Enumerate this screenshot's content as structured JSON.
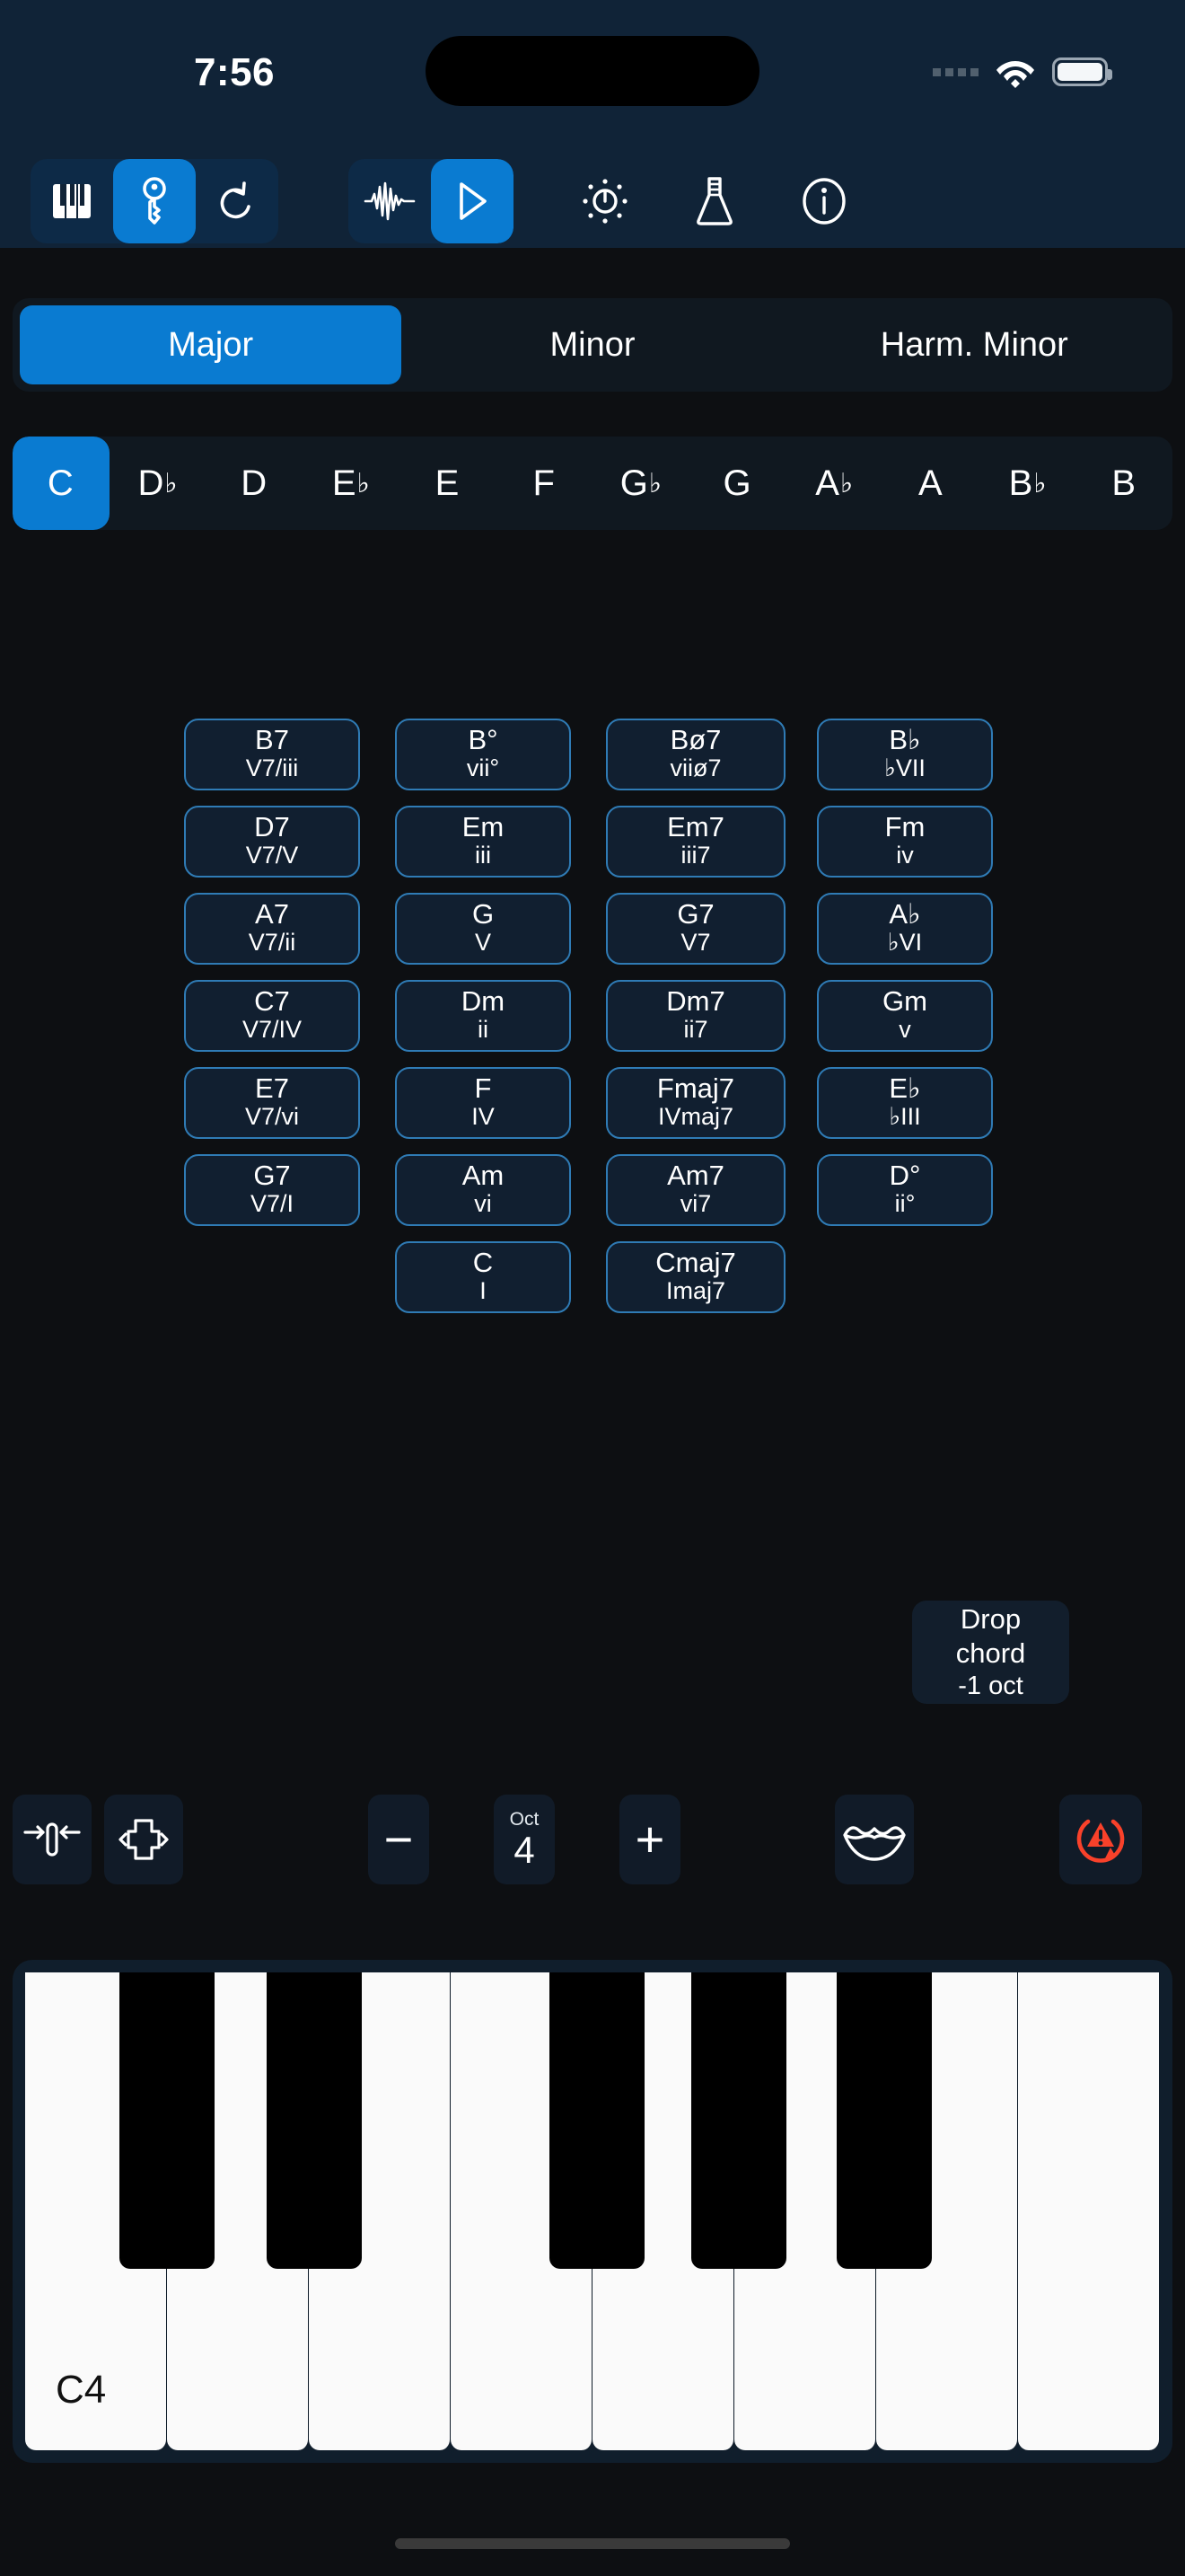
{
  "status_bar": {
    "time": "7:56",
    "icons": [
      "signal-dots-icon",
      "wifi-icon",
      "battery-icon"
    ]
  },
  "toolbar": {
    "left_group": [
      {
        "name": "piano-keys-icon",
        "label": "Keys",
        "active": false
      },
      {
        "name": "key-signature-icon",
        "label": "Key",
        "active": true
      },
      {
        "name": "undo-icon",
        "label": "Undo",
        "active": false
      }
    ],
    "right_group": [
      {
        "name": "waveform-icon",
        "label": "Waveform",
        "active": false
      },
      {
        "name": "play-icon",
        "label": "Play",
        "active": true
      }
    ],
    "extras": [
      {
        "name": "brightness-icon",
        "label": "Brightness"
      },
      {
        "name": "flask-icon",
        "label": "Experiments"
      },
      {
        "name": "info-icon",
        "label": "Info"
      }
    ]
  },
  "scales": {
    "tabs": [
      {
        "label": "Major",
        "active": true
      },
      {
        "label": "Minor",
        "active": false
      },
      {
        "label": "Harm. Minor",
        "active": false
      }
    ]
  },
  "keys": {
    "items": [
      {
        "root": "C",
        "accidental": "",
        "active": true
      },
      {
        "root": "D",
        "accidental": "♭",
        "active": false
      },
      {
        "root": "D",
        "accidental": "",
        "active": false
      },
      {
        "root": "E",
        "accidental": "♭",
        "active": false
      },
      {
        "root": "E",
        "accidental": "",
        "active": false
      },
      {
        "root": "F",
        "accidental": "",
        "active": false
      },
      {
        "root": "G",
        "accidental": "♭",
        "active": false
      },
      {
        "root": "G",
        "accidental": "",
        "active": false
      },
      {
        "root": "A",
        "accidental": "♭",
        "active": false
      },
      {
        "root": "A",
        "accidental": "",
        "active": false
      },
      {
        "root": "B",
        "accidental": "♭",
        "active": false
      },
      {
        "root": "B",
        "accidental": "",
        "active": false
      }
    ]
  },
  "chord_grid": {
    "columns": [
      {
        "id": "secondary-dominants",
        "chords": [
          {
            "name": "B7",
            "numeral": "V7/iii"
          },
          {
            "name": "D7",
            "numeral": "V7/V"
          },
          {
            "name": "A7",
            "numeral": "V7/ii"
          },
          {
            "name": "C7",
            "numeral": "V7/IV"
          },
          {
            "name": "E7",
            "numeral": "V7/vi"
          },
          {
            "name": "G7",
            "numeral": "V7/I"
          }
        ]
      },
      {
        "id": "diatonic-triads",
        "chords": [
          {
            "name": "B°",
            "numeral": "vii°"
          },
          {
            "name": "Em",
            "numeral": "iii"
          },
          {
            "name": "G",
            "numeral": "V"
          },
          {
            "name": "Dm",
            "numeral": "ii"
          },
          {
            "name": "F",
            "numeral": "IV"
          },
          {
            "name": "Am",
            "numeral": "vi"
          },
          {
            "name": "C",
            "numeral": "I"
          }
        ]
      },
      {
        "id": "diatonic-sevenths",
        "chords": [
          {
            "name": "Bø7",
            "numeral": "viiø7"
          },
          {
            "name": "Em7",
            "numeral": "iii7"
          },
          {
            "name": "G7",
            "numeral": "V7"
          },
          {
            "name": "Dm7",
            "numeral": "ii7"
          },
          {
            "name": "Fmaj7",
            "numeral": "IVmaj7"
          },
          {
            "name": "Am7",
            "numeral": "vi7"
          },
          {
            "name": "Cmaj7",
            "numeral": "Imaj7"
          }
        ]
      },
      {
        "id": "borrowed-chords",
        "chords": [
          {
            "name": "B♭",
            "numeral": "♭VII"
          },
          {
            "name": "Fm",
            "numeral": "iv"
          },
          {
            "name": "A♭",
            "numeral": "♭VI"
          },
          {
            "name": "Gm",
            "numeral": "v"
          },
          {
            "name": "E♭",
            "numeral": "♭III"
          },
          {
            "name": "D°",
            "numeral": "ii°"
          }
        ]
      }
    ]
  },
  "drop_chord_tooltip": {
    "line1": "Drop",
    "line2": "chord",
    "line3": "-1 oct"
  },
  "control_bar": {
    "buttons": [
      {
        "name": "narrow-spacing-icon",
        "label": "Narrow voicing"
      },
      {
        "name": "wide-spacing-icon",
        "label": "Wide voicing"
      },
      {
        "name": "octave-minus-button",
        "label": "−"
      },
      {
        "name": "octave-display",
        "label": "Oct",
        "value": "4"
      },
      {
        "name": "octave-plus-button",
        "label": "+"
      },
      {
        "name": "lips-icon",
        "label": "Voicing / mouth"
      },
      {
        "name": "panic-reset-icon",
        "label": "Panic reset"
      }
    ],
    "octave_label": "Oct",
    "octave_value": "4",
    "minus_symbol": "−",
    "plus_symbol": "+"
  },
  "piano": {
    "first_key_label": "C4",
    "white_key_count": 8,
    "black_key_count": 5
  },
  "colors": {
    "accent_blue": "#0a7bd1",
    "panel_navy": "#102337",
    "page_bg": "#0d0f12",
    "chord_fill": "#111f30",
    "chord_border": "#2f7bb5",
    "panic_red": "#f9412a"
  }
}
